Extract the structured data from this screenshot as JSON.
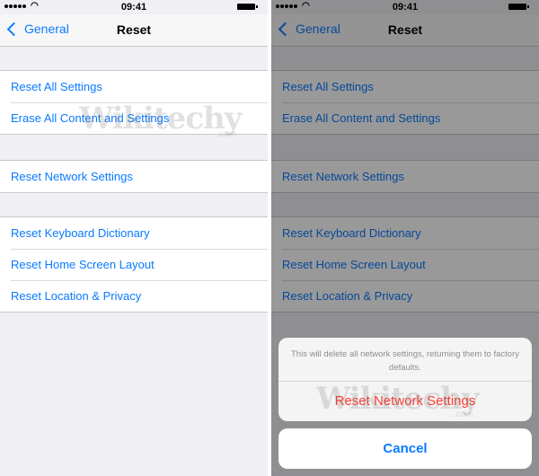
{
  "status_bar": {
    "time": "09:41",
    "signal_icon": "signal-dots-icon",
    "wifi_icon": "wifi-icon",
    "battery_icon": "battery-icon"
  },
  "nav": {
    "back_label": "General",
    "title": "Reset",
    "back_icon": "chevron-left-icon"
  },
  "groups": [
    {
      "items": [
        "Reset All Settings",
        "Erase All Content and Settings"
      ]
    },
    {
      "items": [
        "Reset Network Settings"
      ]
    },
    {
      "items": [
        "Reset Keyboard Dictionary",
        "Reset Home Screen Layout",
        "Reset Location & Privacy"
      ]
    }
  ],
  "action_sheet": {
    "message": "This will delete all network settings, returning them to factory defaults.",
    "destructive_label": "Reset Network Settings",
    "cancel_label": "Cancel"
  },
  "watermark": {
    "text": "Wikitechy",
    "suffix": ".com"
  },
  "colors": {
    "accent": "#0a7aff",
    "destructive": "#ff3b30",
    "background": "#efeff4"
  }
}
